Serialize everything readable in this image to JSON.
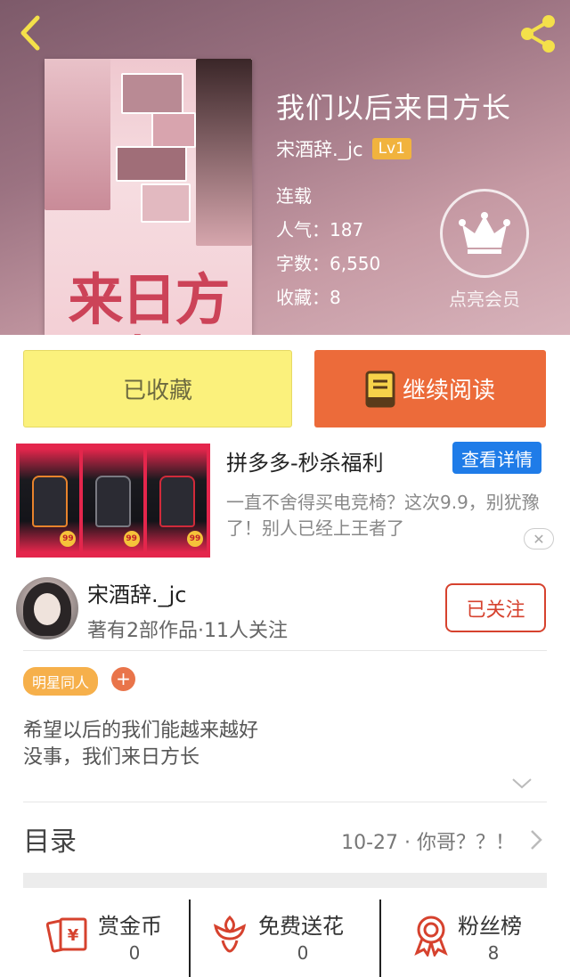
{
  "book": {
    "title": "我们以后来日方长",
    "author": "宋酒辞._jc",
    "level": "Lv1",
    "status": "连载",
    "popularity": "人气：187",
    "word_count": "字数：6,550",
    "favorites": "收藏：8",
    "cover_text": "来日方长"
  },
  "vip": {
    "label": "点亮会员"
  },
  "actions": {
    "collected_label": "已收藏",
    "continue_label": "继续阅读"
  },
  "ad": {
    "title": "拼多多-秒杀福利",
    "detail_button": "查看详情",
    "description": "一直不舍得买电竞椅？这次9.9，别犹豫了！别人已经上王者了",
    "close_symbol": "✕",
    "price_badge": "99"
  },
  "author_card": {
    "name": "宋酒辞._jc",
    "meta": "著有2部作品·11人关注",
    "follow_label": "已关注"
  },
  "tags": {
    "items": [
      "明星同人"
    ],
    "add_symbol": "+"
  },
  "intro": {
    "line1": "希望以后的我们能越来越好",
    "line2": "没事，我们来日方长"
  },
  "toc": {
    "label": "目录",
    "latest": "10-27 · 你哥？？！"
  },
  "bottom": {
    "reward": {
      "label": "赏金币",
      "count": "0"
    },
    "flower": {
      "label": "免费送花",
      "count": "0"
    },
    "fans": {
      "label": "粉丝榜",
      "count": "8"
    }
  },
  "colors": {
    "accent_orange": "#ec6b3a",
    "collected_yellow": "#fbf17c",
    "follow_red": "#d6422e",
    "ad_blue": "#1f7ce8",
    "level_badge": "#f1b33e",
    "icon_red": "#d6422e"
  }
}
